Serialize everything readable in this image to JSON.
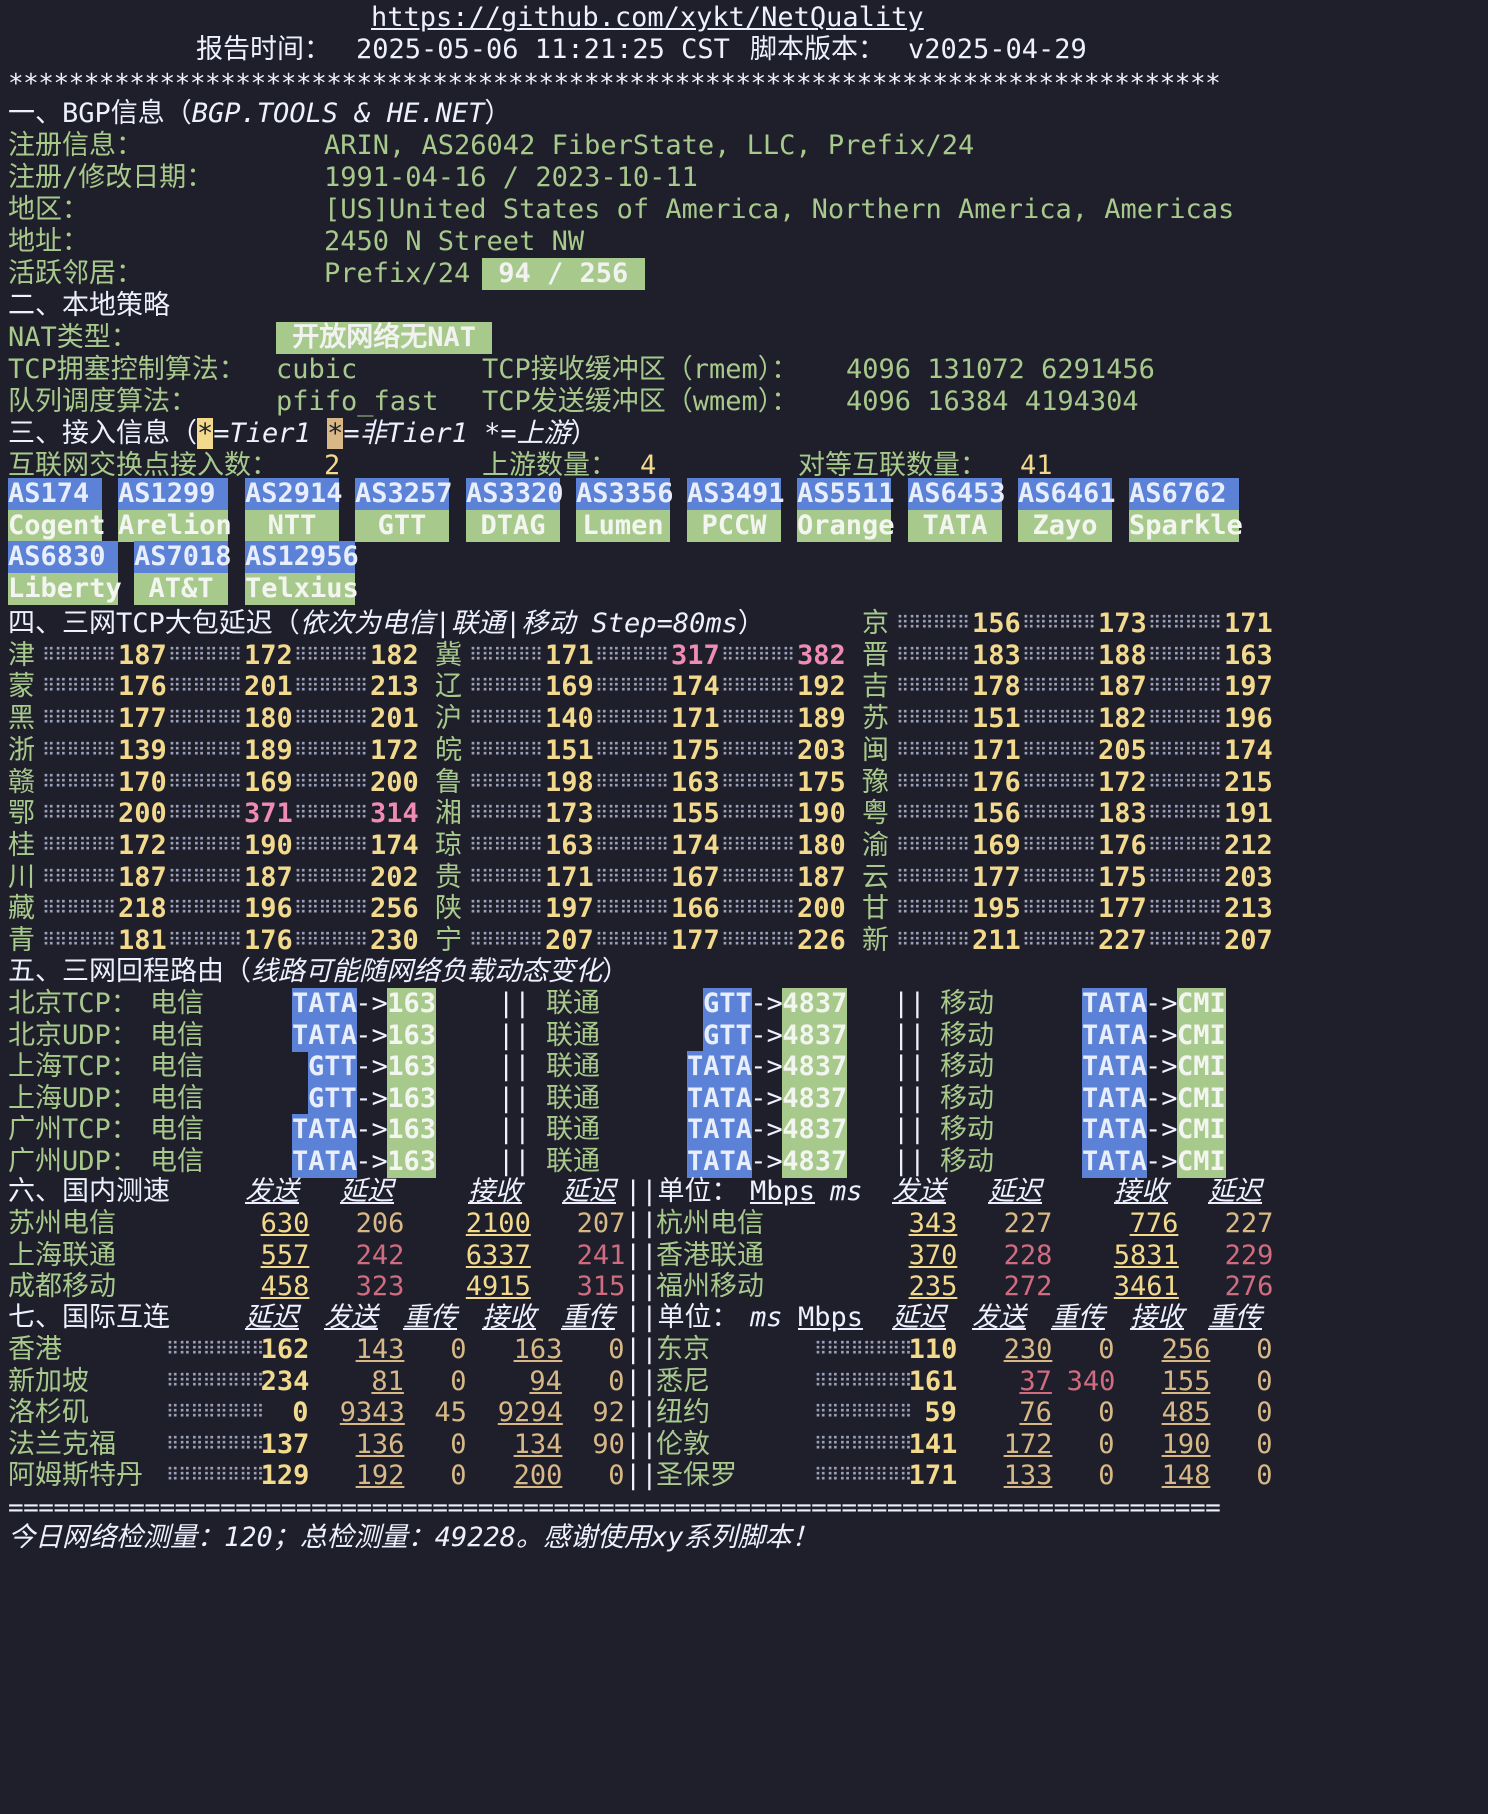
{
  "header": {
    "url": "https://github.com/xykt/NetQuality",
    "report_time_label": "报告时间：",
    "report_time": "2025-05-06 11:21:25 CST",
    "version_label": "脚本版本：",
    "version": "v2025-04-29",
    "stars": "********************************************************************************"
  },
  "bgp": {
    "title_a": "一、BGP信息（",
    "title_b": "BGP.TOOLS & HE.NET",
    "title_c": "）",
    "reg_label": "注册信息：",
    "reg": "ARIN, AS26042 FiberState, LLC, Prefix/24",
    "date_label": "注册/修改日期：",
    "date": "1991-04-16 / 2023-10-11",
    "region_label": "地区：",
    "region": "[US]United States of America, Northern America, Americas",
    "addr_label": "地址：",
    "addr": "2450 N Street NW",
    "nb_label": "活跃邻居：",
    "nb": "Prefix/24",
    "nb_count": " 94 / 256 "
  },
  "policy": {
    "title": "二、本地策略",
    "nat_label": "NAT类型：",
    "nat": " 开放网络无NAT ",
    "tcp_label": "TCP拥塞控制算法：",
    "tcp": "cubic",
    "rmem_label": "TCP接收缓冲区（rmem）：",
    "rmem": "4096 131072 6291456",
    "q_label": "队列调度算法：",
    "q": "pfifo_fast",
    "wmem_label": "TCP发送缓冲区（wmem）：",
    "wmem": "4096 16384 4194304"
  },
  "access": {
    "title_a": "三、接入信息（",
    "s1": "*",
    "t1": "=Tier1 ",
    "s2": "*",
    "t2": "=非Tier1 ",
    "s3": "*",
    "t3": "=上游",
    "title_c": "）",
    "ix_label": "互联网交换点接入数：",
    "ix": "2",
    "up_label": "上游数量：",
    "up": "4",
    "peer_label": "对等互联数量：",
    "peer": "41",
    "asns": [
      {
        "as": "AS174",
        "name": "Cogent"
      },
      {
        "as": "AS1299",
        "name": "Arelion"
      },
      {
        "as": "AS2914",
        "name": "NTT"
      },
      {
        "as": "AS3257",
        "name": "GTT"
      },
      {
        "as": "AS3320",
        "name": "DTAG"
      },
      {
        "as": "AS3356",
        "name": "Lumen"
      },
      {
        "as": "AS3491",
        "name": "PCCW"
      },
      {
        "as": "AS5511",
        "name": "Orange"
      },
      {
        "as": "AS6453",
        "name": "TATA"
      },
      {
        "as": "AS6461",
        "name": "Zayo"
      },
      {
        "as": "AS6762",
        "name": "Sparkle"
      },
      {
        "as": "AS6830",
        "name": "Liberty"
      },
      {
        "as": "AS7018",
        "name": "AT&T"
      },
      {
        "as": "AS12956",
        "name": "Telxius"
      }
    ]
  },
  "latency": {
    "title_a": "四、三网TCP大包延迟（",
    "title_b": "依次为电信|联通|移动 Step=80ms",
    "title_c": "）",
    "provinces": [
      {
        "n": "京",
        "v": [
          "156",
          "173",
          "171"
        ]
      },
      {
        "n": "津",
        "v": [
          "187",
          "172",
          "182"
        ]
      },
      {
        "n": "冀",
        "v": [
          "171",
          "317",
          "382"
        ]
      },
      {
        "n": "晋",
        "v": [
          "183",
          "188",
          "163"
        ]
      },
      {
        "n": "蒙",
        "v": [
          "176",
          "201",
          "213"
        ]
      },
      {
        "n": "辽",
        "v": [
          "169",
          "174",
          "192"
        ]
      },
      {
        "n": "吉",
        "v": [
          "178",
          "187",
          "197"
        ]
      },
      {
        "n": "黑",
        "v": [
          "177",
          "180",
          "201"
        ]
      },
      {
        "n": "沪",
        "v": [
          "140",
          "171",
          "189"
        ]
      },
      {
        "n": "苏",
        "v": [
          "151",
          "182",
          "196"
        ]
      },
      {
        "n": "浙",
        "v": [
          "139",
          "189",
          "172"
        ]
      },
      {
        "n": "皖",
        "v": [
          "151",
          "175",
          "203"
        ]
      },
      {
        "n": "闽",
        "v": [
          "171",
          "205",
          "174"
        ]
      },
      {
        "n": "赣",
        "v": [
          "170",
          "169",
          "200"
        ]
      },
      {
        "n": "鲁",
        "v": [
          "198",
          "163",
          "175"
        ]
      },
      {
        "n": "豫",
        "v": [
          "176",
          "172",
          "215"
        ]
      },
      {
        "n": "鄂",
        "v": [
          "200",
          "371",
          "314"
        ]
      },
      {
        "n": "湘",
        "v": [
          "173",
          "155",
          "190"
        ]
      },
      {
        "n": "粤",
        "v": [
          "156",
          "183",
          "191"
        ]
      },
      {
        "n": "桂",
        "v": [
          "172",
          "190",
          "174"
        ]
      },
      {
        "n": "琼",
        "v": [
          "163",
          "174",
          "180"
        ]
      },
      {
        "n": "渝",
        "v": [
          "169",
          "176",
          "212"
        ]
      },
      {
        "n": "川",
        "v": [
          "187",
          "187",
          "202"
        ]
      },
      {
        "n": "贵",
        "v": [
          "171",
          "167",
          "187"
        ]
      },
      {
        "n": "云",
        "v": [
          "177",
          "175",
          "203"
        ]
      },
      {
        "n": "藏",
        "v": [
          "218",
          "196",
          "256"
        ]
      },
      {
        "n": "陕",
        "v": [
          "197",
          "166",
          "200"
        ]
      },
      {
        "n": "甘",
        "v": [
          "195",
          "177",
          "213"
        ]
      },
      {
        "n": "青",
        "v": [
          "181",
          "176",
          "230"
        ]
      },
      {
        "n": "宁",
        "v": [
          "207",
          "177",
          "226"
        ]
      },
      {
        "n": "新",
        "v": [
          "211",
          "227",
          "207"
        ]
      }
    ]
  },
  "routes": {
    "title_a": "五、三网回程路由（",
    "title_b": "线路可能随网络负载动态变化",
    "title_c": "）",
    "ct": "电信",
    "cu": "联通",
    "cm": "移动",
    "sep": "||",
    "arrow": "->",
    "rows": [
      {
        "label": "北京TCP：",
        "ct": [
          "TATA",
          "163"
        ],
        "cu": [
          "GTT",
          "4837"
        ],
        "cm": [
          "TATA",
          "CMI"
        ]
      },
      {
        "label": "北京UDP：",
        "ct": [
          "TATA",
          "163"
        ],
        "cu": [
          "GTT",
          "4837"
        ],
        "cm": [
          "TATA",
          "CMI"
        ]
      },
      {
        "label": "上海TCP：",
        "ct": [
          "GTT",
          "163"
        ],
        "cu": [
          "TATA",
          "4837"
        ],
        "cm": [
          "TATA",
          "CMI"
        ]
      },
      {
        "label": "上海UDP：",
        "ct": [
          "GTT",
          "163"
        ],
        "cu": [
          "TATA",
          "4837"
        ],
        "cm": [
          "TATA",
          "CMI"
        ]
      },
      {
        "label": "广州TCP：",
        "ct": [
          "TATA",
          "163"
        ],
        "cu": [
          "TATA",
          "4837"
        ],
        "cm": [
          "TATA",
          "CMI"
        ]
      },
      {
        "label": "广州UDP：",
        "ct": [
          "TATA",
          "163"
        ],
        "cu": [
          "TATA",
          "4837"
        ],
        "cm": [
          "TATA",
          "CMI"
        ]
      }
    ]
  },
  "domestic": {
    "title": "六、国内测速",
    "h_send": "发送",
    "h_lat": "延迟",
    "h_recv": "接收",
    "unit_label": "||单位：",
    "unit_a": "Mbps",
    "unit_b": "ms",
    "rows": [
      {
        "a": "苏州电信",
        "s": "630",
        "l1": "206",
        "r": "2100",
        "l2": "207",
        "b": "杭州电信",
        "s2": "343",
        "l3": "227",
        "r2": "776",
        "l4": "227"
      },
      {
        "a": "上海联通",
        "s": "557",
        "l1": "242",
        "r": "6337",
        "l2": "241",
        "b": "香港联通",
        "s2": "370",
        "l3": "228",
        "r2": "5831",
        "l4": "229"
      },
      {
        "a": "成都移动",
        "s": "458",
        "l1": "323",
        "r": "4915",
        "l2": "315",
        "b": "福州移动",
        "s2": "235",
        "l3": "272",
        "r2": "3461",
        "l4": "276"
      }
    ]
  },
  "intl": {
    "title": "七、国际互连",
    "h_lat": "延迟",
    "h_send": "发送",
    "h_re": "重传",
    "h_recv": "接收",
    "unit_label": "||单位：",
    "unit_a": "ms",
    "unit_b": "Mbps",
    "rows": [
      {
        "a": "香港",
        "lat": "162",
        "s": "143",
        "rs": "0",
        "r": "163",
        "rr": "0",
        "b": "东京",
        "lat2": "110",
        "s2": "230",
        "rs2": "0",
        "r2": "256",
        "rr2": "0"
      },
      {
        "a": "新加坡",
        "lat": "234",
        "s": "81",
        "rs": "0",
        "r": "94",
        "rr": "0",
        "b": "悉尼",
        "lat2": "161",
        "s2": "37",
        "rs2": "340",
        "r2": "155",
        "rr2": "0"
      },
      {
        "a": "洛杉矶",
        "lat": "0",
        "s": "9343",
        "rs": "45",
        "r": "9294",
        "rr": "92",
        "b": "纽约",
        "lat2": "59",
        "s2": "76",
        "rs2": "0",
        "r2": "485",
        "rr2": "0"
      },
      {
        "a": "法兰克福",
        "lat": "137",
        "s": "136",
        "rs": "0",
        "r": "134",
        "rr": "90",
        "b": "伦敦",
        "lat2": "141",
        "s2": "172",
        "rs2": "0",
        "r2": "190",
        "rr2": "0"
      },
      {
        "a": "阿姆斯特丹",
        "lat": "129",
        "s": "192",
        "rs": "0",
        "r": "200",
        "rr": "0",
        "b": "圣保罗",
        "lat2": "171",
        "s2": "133",
        "rs2": "0",
        "r2": "148",
        "rr2": "0"
      }
    ]
  },
  "footer": {
    "rule": "================================================================================",
    "text": "今日网络检测量：120；总检测量：49228。感谢使用xy系列脚本！"
  }
}
